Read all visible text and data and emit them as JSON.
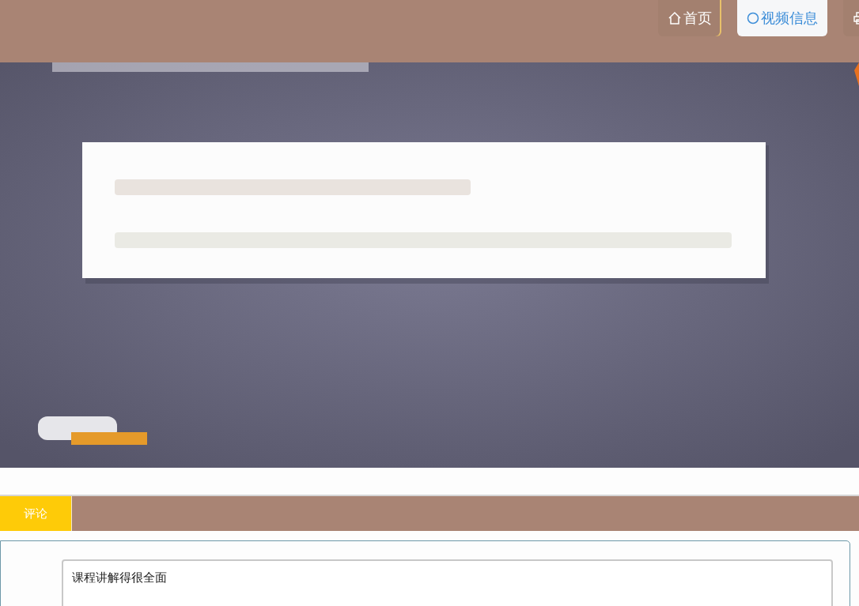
{
  "nav": [
    {
      "kind": "home",
      "label": "首页",
      "selected": false
    },
    {
      "kind": "video",
      "label": "视频信息",
      "selected": true
    },
    {
      "kind": "system",
      "selected": false
    }
  ],
  "tabs": [
    {
      "label": "评论",
      "selected": true
    }
  ],
  "comment": {
    "value": "课程讲解得很全面"
  }
}
